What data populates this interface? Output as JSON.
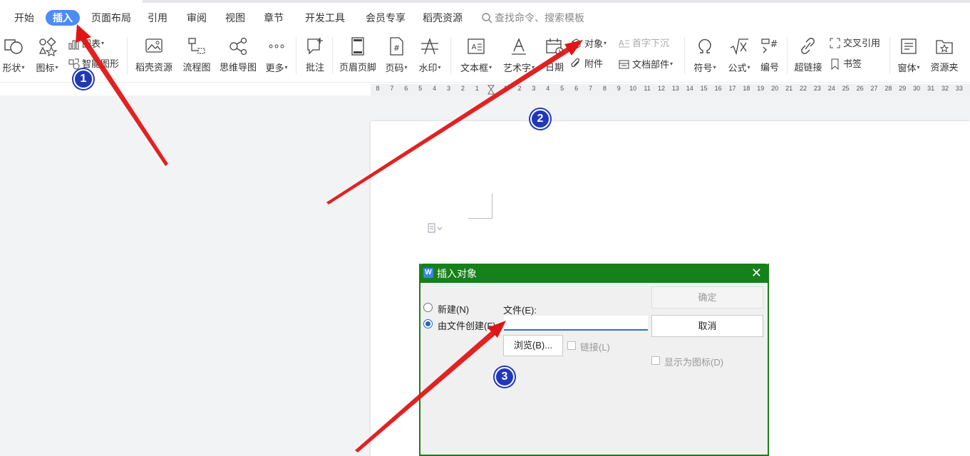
{
  "menu": {
    "items": [
      "开始",
      "插入",
      "页面布局",
      "引用",
      "审阅",
      "视图",
      "章节",
      "开发工具",
      "会员专享",
      "稻壳资源"
    ],
    "active": "插入",
    "search_placeholder": "查找命令、搜索模板"
  },
  "ribbon": {
    "shape": "形状",
    "icon": "图标",
    "chart": "图表",
    "smart_graphic": "智能图形",
    "docer_resource": "稻壳资源",
    "flowchart": "流程图",
    "mindmap": "思维导图",
    "more": "更多",
    "comment": "批注",
    "header_footer": "页眉页脚",
    "page_number": "页码",
    "watermark": "水印",
    "textbox": "文本框",
    "wordart": "艺术字",
    "datetime": "日期",
    "object": "对象",
    "dropcap": "首字下沉",
    "attachment": "附件",
    "doc_parts": "文档部件",
    "symbol": "符号",
    "formula": "公式",
    "numbering": "编号",
    "hyperlink": "超链接",
    "cross_ref": "交叉引用",
    "bookmark": "书签",
    "form": "窗体",
    "resource_folder": "资源夹"
  },
  "ruler": [
    "8",
    "7",
    "6",
    "5",
    "4",
    "3",
    "2",
    "1",
    "",
    "1",
    "2",
    "3",
    "4",
    "5",
    "6",
    "7",
    "8",
    "9",
    "10",
    "11",
    "12",
    "13",
    "14",
    "15",
    "16",
    "17",
    "18",
    "19",
    "20",
    "21",
    "22",
    "23",
    "24",
    "25",
    "26",
    "27",
    "28",
    "29",
    "30",
    "31",
    "32",
    "33"
  ],
  "dialog": {
    "title": "插入对象",
    "new_option": "新建(N)",
    "from_file_option": "由文件创建(F)",
    "file_label": "文件(E):",
    "file_value": "",
    "browse": "浏览(B)...",
    "link": "链接(L)",
    "show_as_icon": "显示为图标(D)",
    "ok": "确定",
    "cancel": "取消"
  },
  "annotations": [
    "1",
    "2",
    "3"
  ],
  "colors": {
    "active_tab": "#4b8cf5",
    "dialog_title": "#16801a",
    "arrow": "#e01515",
    "badge": "#2038b8"
  }
}
